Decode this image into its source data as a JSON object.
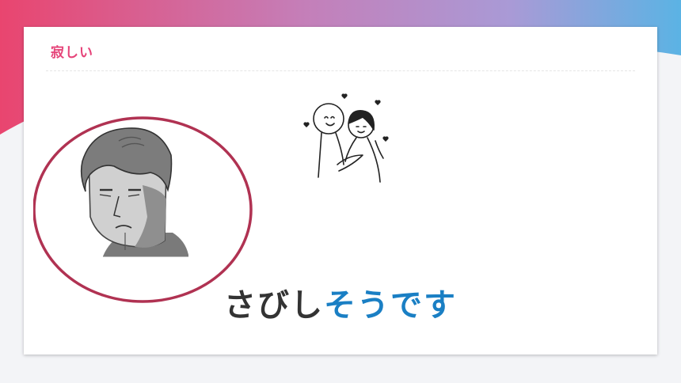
{
  "slide": {
    "title": "寂しい",
    "caption_dark": "さびし",
    "caption_accent": "そうです"
  },
  "colors": {
    "title": "#e6457a",
    "caption_dark": "#333333",
    "caption_accent": "#1a7fc4",
    "circle_outline": "#b03252"
  },
  "icons": {
    "couple": "couple-hugging-illustration",
    "sad": "sad-man-illustration"
  }
}
